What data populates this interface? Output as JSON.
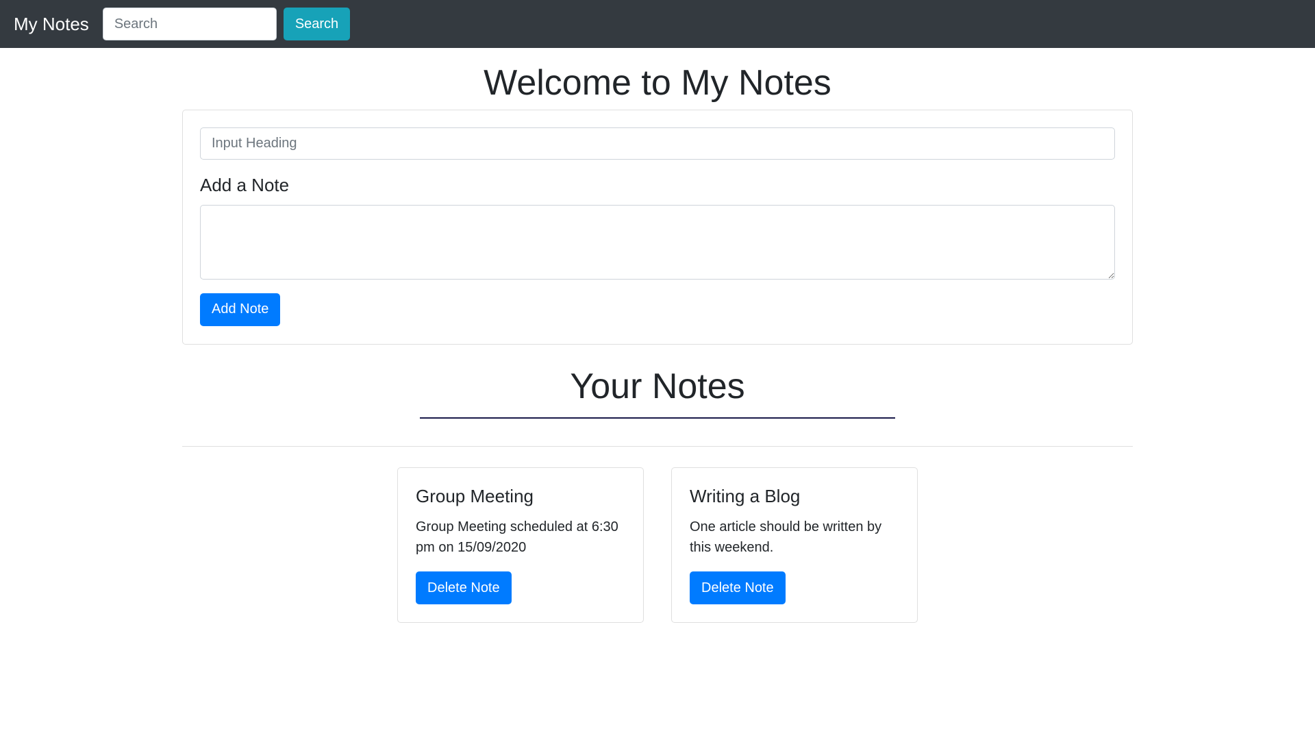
{
  "navbar": {
    "brand": "My Notes",
    "search_placeholder": "Search",
    "search_button": "Search"
  },
  "main": {
    "title": "Welcome to My Notes",
    "form": {
      "heading_placeholder": "Input Heading",
      "note_label": "Add a Note",
      "note_value": "",
      "add_button": "Add Note"
    },
    "notes_title": "Your Notes",
    "notes": [
      {
        "title": "Group Meeting",
        "text": "Group Meeting scheduled at 6:30 pm on 15/09/2020",
        "delete_label": "Delete Note"
      },
      {
        "title": "Writing a Blog",
        "text": "One article should be written by this weekend.",
        "delete_label": "Delete Note"
      }
    ]
  },
  "colors": {
    "navbar_bg": "#343a40",
    "primary": "#007bff",
    "info": "#17a2b8"
  }
}
